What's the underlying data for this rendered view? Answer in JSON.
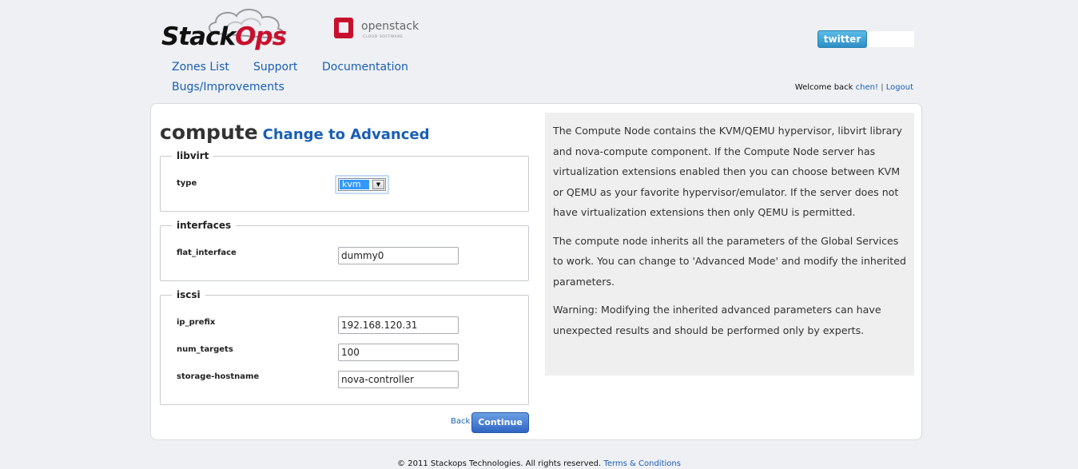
{
  "header": {
    "logo_stackops": {
      "part1": "Stack",
      "part2": "Ops"
    },
    "logo_openstack": {
      "name": "openstack",
      "tagline": "CLOUD SOFTWARE"
    },
    "twitter_label": "twitter",
    "nav": {
      "zones_list": "Zones List",
      "support": "Support",
      "documentation": "Documentation",
      "bugs": "Bugs/Improvements"
    },
    "welcome_prefix": "Welcome back",
    "username": "chen!",
    "separator": "|",
    "logout": "Logout"
  },
  "main": {
    "title": "compute",
    "advanced_link": "Change to Advanced",
    "sections": {
      "libvirt": {
        "legend": "libvirt",
        "type_label": "type",
        "type_value": "kvm"
      },
      "interfaces": {
        "legend": "interfaces",
        "flat_interface_label": "flat_interface",
        "flat_interface_value": "dummy0"
      },
      "iscsi": {
        "legend": "iscsi",
        "ip_prefix_label": "ip_prefix",
        "ip_prefix_value": "192.168.120.31",
        "num_targets_label": "num_targets",
        "num_targets_value": "100",
        "storage_hostname_label": "storage-hostname",
        "storage_hostname_value": "nova-controller"
      }
    },
    "back_label": "Back",
    "continue_label": "Continue"
  },
  "help": {
    "p1": "The Compute Node contains the KVM/QEMU hypervisor, libvirt library and nova-compute component. If the Compute Node server has virtualization extensions enabled then you can choose between KVM or QEMU as your favorite hypervisor/emulator. If the server does not have virtualization extensions then only QEMU is permitted.",
    "p2": "The compute node inherits all the parameters of the Global Services to work. You can change to 'Advanced Mode' and modify the inherited parameters.",
    "p3": "Warning: Modifying the inherited advanced parameters can have unexpected results and should be performed only by experts."
  },
  "footer": {
    "copyright": "© 2011 Stackops Technologies. All rights reserved.",
    "terms": "Terms & Conditions"
  },
  "colors": {
    "link": "#1a5fb4",
    "brand_red": "#c8102e",
    "button_blue": "#2f66c4",
    "twitter_blue": "#2f8fc6",
    "help_bg": "#efefef",
    "page_bg": "#eef0f3"
  }
}
